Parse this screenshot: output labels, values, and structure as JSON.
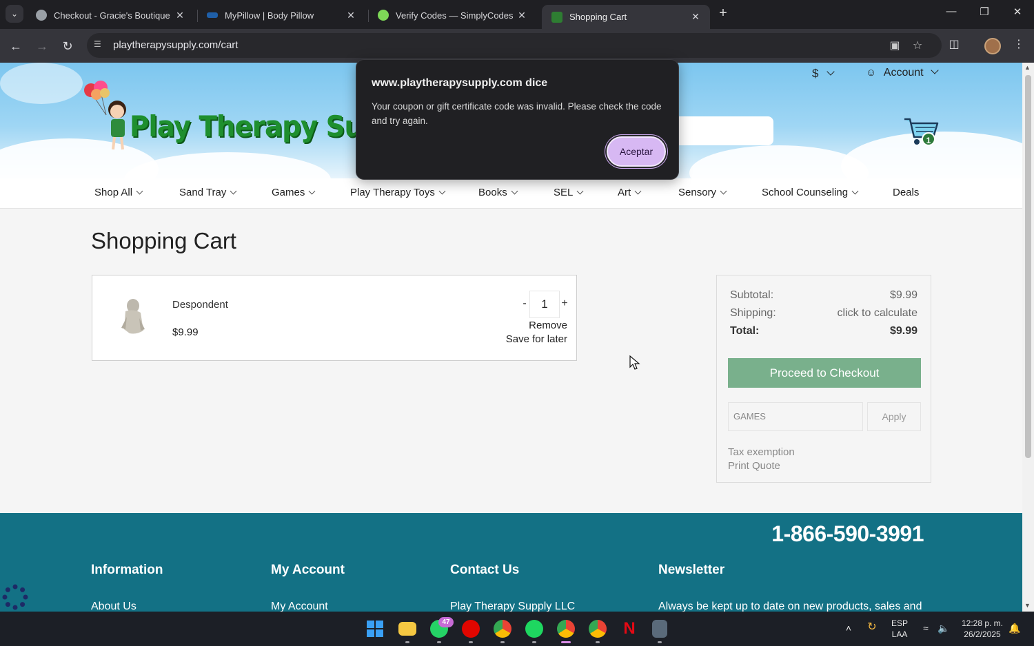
{
  "browser": {
    "tabs": [
      {
        "label": "Checkout - Gracie's Boutique",
        "active": false
      },
      {
        "label": "MyPillow | Body Pillow",
        "active": false
      },
      {
        "label": "Verify Codes — SimplyCodes",
        "active": false
      },
      {
        "label": "Shopping Cart",
        "active": true
      }
    ],
    "url": "playtherapysupply.com/cart"
  },
  "header": {
    "logo_text": "Play Therapy Supply",
    "currency": "$",
    "account": "Account",
    "cart_count": "1"
  },
  "nav": {
    "items": [
      "Shop All",
      "Sand Tray",
      "Games",
      "Play Therapy Toys",
      "Books",
      "SEL",
      "Art",
      "Sensory",
      "School Counseling",
      "Deals"
    ]
  },
  "cart": {
    "title": "Shopping Cart",
    "item": {
      "name": "Despondent",
      "price": "$9.99",
      "qty_minus": "-",
      "quantity": "1",
      "qty_plus": "+",
      "remove": "Remove",
      "save_later": "Save for later"
    }
  },
  "summary": {
    "subtotal_label": "Subtotal:",
    "subtotal": "$9.99",
    "shipping_label": "Shipping:",
    "shipping": "click to calculate",
    "total_label": "Total:",
    "total": "$9.99",
    "checkout": "Proceed to Checkout",
    "coupon_value": "GAMES",
    "apply": "Apply",
    "tax_exemption": "Tax exemption",
    "print_quote": "Print Quote"
  },
  "footer": {
    "phone": "1-866-590-3991",
    "col1_head": "Information",
    "col1_link": "About Us",
    "col2_head": "My Account",
    "col2_link": "My Account",
    "col3_head": "Contact Us",
    "col3_link": "Play Therapy Supply LLC",
    "col4_head": "Newsletter",
    "col4_text": "Always be kept up to date on new products, sales and"
  },
  "dialog": {
    "title": "www.playtherapysupply.com dice",
    "message": "Your coupon or gift certificate code was invalid. Please check the code and try again.",
    "button": "Aceptar"
  },
  "taskbar": {
    "whatsapp_badge": "47",
    "lang": "ESP",
    "layout": "LAA",
    "time": "12:28 p. m.",
    "date": "26/2/2025"
  },
  "colors": {
    "checkout_green": "#79b08c",
    "footer_teal": "#137185",
    "dialog_button": "#d7b8f3"
  }
}
